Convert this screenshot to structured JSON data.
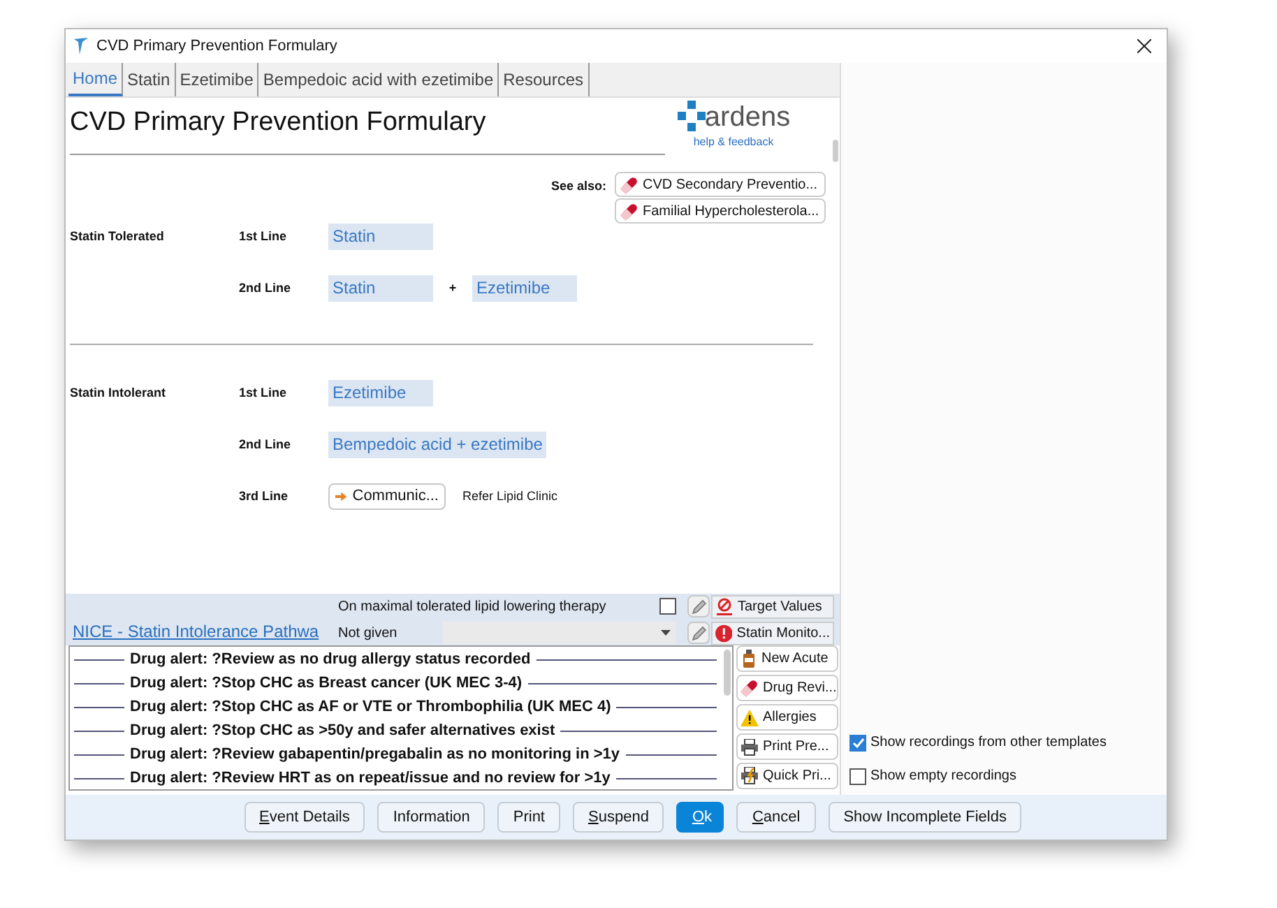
{
  "window": {
    "title": "CVD Primary Prevention Formulary"
  },
  "tabs": [
    {
      "label": "Home",
      "selected": true
    },
    {
      "label": "Statin",
      "selected": false
    },
    {
      "label": "Ezetimibe",
      "selected": false
    },
    {
      "label": "Bempedoic acid with ezetimibe",
      "selected": false
    },
    {
      "label": "Resources",
      "selected": false
    }
  ],
  "heading": "CVD Primary Prevention Formulary",
  "logo": {
    "name": "ardens",
    "link": "help & feedback"
  },
  "see_also": {
    "label": "See also:",
    "items": [
      "CVD Secondary Preventio...",
      "Familial Hypercholesterola..."
    ]
  },
  "sections": [
    {
      "title": "Statin Tolerated",
      "rows": [
        {
          "label": "1st Line",
          "items": [
            {
              "kind": "chip",
              "text": "Statin"
            }
          ]
        },
        {
          "label": "2nd Line",
          "items": [
            {
              "kind": "chip",
              "text": "Statin"
            },
            {
              "kind": "plus",
              "text": "+"
            },
            {
              "kind": "chip",
              "text": "Ezetimibe"
            }
          ]
        }
      ]
    },
    {
      "title": "Statin Intolerant",
      "rows": [
        {
          "label": "1st Line",
          "items": [
            {
              "kind": "chip",
              "text": "Ezetimibe"
            }
          ]
        },
        {
          "label": "2nd Line",
          "items": [
            {
              "kind": "chip",
              "text": "Bempedoic acid + ezetimibe"
            }
          ]
        },
        {
          "label": "3rd Line",
          "items": [
            {
              "kind": "button",
              "text": "Communic..."
            },
            {
              "kind": "note",
              "text": "Refer Lipid Clinic"
            }
          ]
        }
      ]
    }
  ],
  "pathway": {
    "link": "NICE - Statin Intolerance Pathwa",
    "fields": [
      {
        "kind": "checkbox",
        "label": "On maximal tolerated lipid lowering therapy",
        "checked": false,
        "action": "Target Values"
      },
      {
        "kind": "dropdown",
        "label": "Not given",
        "action": "Statin Monito..."
      }
    ]
  },
  "alerts": [
    "Drug alert: ?Review as no drug allergy status recorded",
    "Drug alert: ?Stop CHC as Breast cancer (UK MEC 3-4)",
    "Drug alert: ?Stop CHC as AF or VTE or Thrombophilia (UK MEC 4)",
    "Drug alert: ?Stop CHC as >50y and safer alternatives exist",
    "Drug alert: ?Review gabapentin/pregabalin as no monitoring in >1y",
    "Drug alert: ?Review HRT as on repeat/issue and no review for >1y"
  ],
  "side_buttons": [
    {
      "kind": "bottle",
      "label": "New Acute"
    },
    {
      "kind": "pill",
      "label": "Drug Revi..."
    },
    {
      "kind": "warning",
      "label": "Allergies"
    },
    {
      "kind": "printer",
      "label": "Print Pre..."
    },
    {
      "kind": "quickprint",
      "label": "Quick Pri..."
    }
  ],
  "options": [
    {
      "label": "Show recordings from other templates",
      "checked": true
    },
    {
      "label": "Show empty recordings",
      "checked": false
    }
  ],
  "footer_buttons": [
    {
      "label": "Event Details",
      "underline_first": true,
      "primary": false
    },
    {
      "label": "Information",
      "underline_first": false,
      "primary": false
    },
    {
      "label": "Print",
      "underline_first": false,
      "primary": false
    },
    {
      "label": "Suspend",
      "underline_first": true,
      "primary": false
    },
    {
      "label": "Ok",
      "underline_first": true,
      "primary": true
    },
    {
      "label": "Cancel",
      "underline_first": true,
      "primary": false
    },
    {
      "label": "Show Incomplete Fields",
      "underline_first": false,
      "primary": false
    }
  ]
}
